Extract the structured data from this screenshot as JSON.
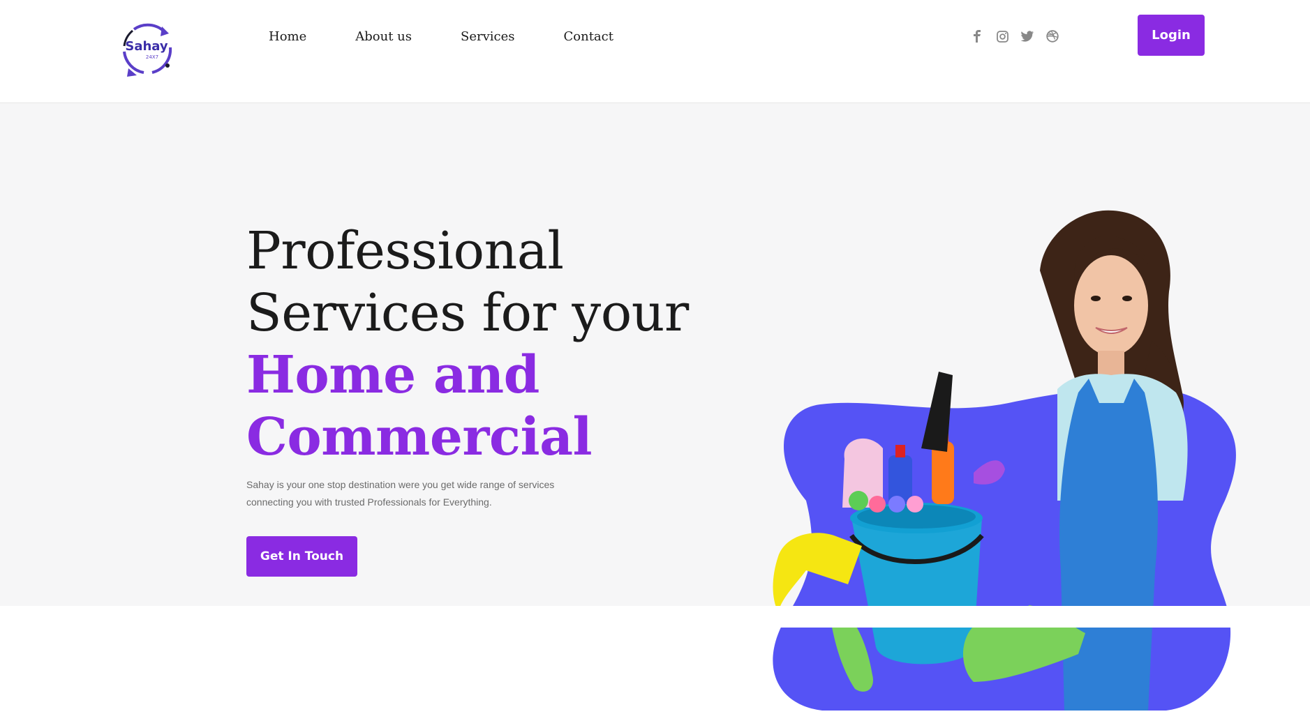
{
  "brand": {
    "name": "Sahay",
    "tagline": "24X7"
  },
  "nav": {
    "items": [
      "Home",
      "About us",
      "Services",
      "Contact"
    ]
  },
  "social": [
    "facebook-icon",
    "instagram-icon",
    "twitter-icon",
    "dribbble-icon"
  ],
  "header": {
    "login_label": "Login"
  },
  "hero": {
    "line1": "Professional",
    "line2": "Services for your",
    "accent_line1": "Home and",
    "accent_line2": "Commercial",
    "subtext_line1": "Sahay is your one stop destination were you get wide range of services",
    "subtext_line2": "connecting you with trusted Professionals for Everything.",
    "cta_label": "Get In Touch"
  },
  "colors": {
    "accent": "#8a2be2",
    "blob": "#5553f5",
    "hero_bg": "#f6f6f7"
  }
}
